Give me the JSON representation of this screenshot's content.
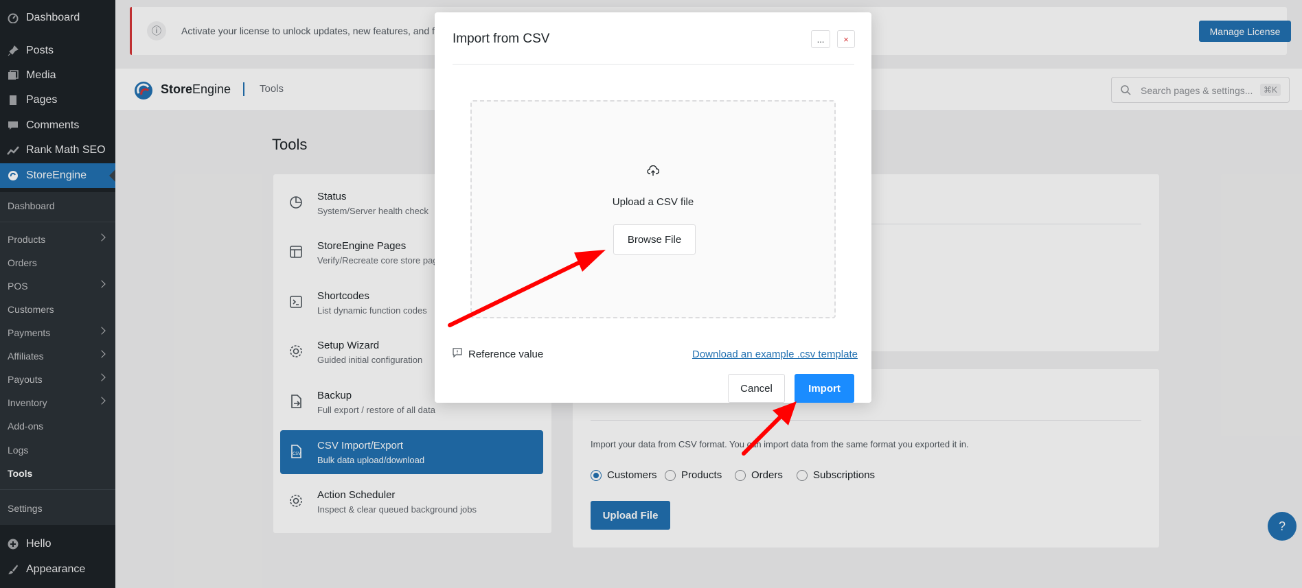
{
  "sidebar": {
    "items": [
      {
        "label": "Dashboard",
        "icon": "dashboard-icon"
      },
      {
        "label": "Posts",
        "icon": "pin-icon"
      },
      {
        "label": "Media",
        "icon": "media-icon"
      },
      {
        "label": "Pages",
        "icon": "pages-icon"
      },
      {
        "label": "Comments",
        "icon": "comment-icon"
      },
      {
        "label": "Rank Math SEO",
        "icon": "chart-icon"
      },
      {
        "label": "StoreEngine",
        "icon": "storeengine-icon"
      }
    ],
    "submenu": [
      {
        "label": "Dashboard"
      },
      {
        "label": "Products"
      },
      {
        "label": "Orders"
      },
      {
        "label": "POS"
      },
      {
        "label": "Customers"
      },
      {
        "label": "Payments"
      },
      {
        "label": "Affiliates"
      },
      {
        "label": "Payouts"
      },
      {
        "label": "Inventory"
      },
      {
        "label": "Add-ons"
      },
      {
        "label": "Logs"
      },
      {
        "label": "Tools"
      },
      {
        "label": "Settings"
      }
    ],
    "bottom": [
      {
        "label": "Hello",
        "icon": "plus-circle-icon"
      },
      {
        "label": "Appearance",
        "icon": "brush-icon"
      }
    ]
  },
  "license": {
    "text": "Activate your license to unlock updates, new features, and fu",
    "button": "Manage License"
  },
  "topbar": {
    "brand_bold": "Store",
    "brand_rest": "Engine",
    "crumb": "Tools",
    "search_placeholder": "Search pages & settings...",
    "search_kbd": "⌘K"
  },
  "tools": {
    "heading": "Tools",
    "items": [
      {
        "title": "Status",
        "desc": "System/Server health check"
      },
      {
        "title": "StoreEngine Pages",
        "desc": "Verify/Recreate core store pag"
      },
      {
        "title": "Shortcodes",
        "desc": "List dynamic function codes"
      },
      {
        "title": "Setup Wizard",
        "desc": "Guided initial configuration"
      },
      {
        "title": "Backup",
        "desc": "Full export / restore of all data"
      },
      {
        "title": "CSV Import/Export",
        "desc": "Bulk data upload/download"
      },
      {
        "title": "Action Scheduler",
        "desc": "Inspect & clear queued background jobs"
      }
    ]
  },
  "import_section": {
    "desc": "Import your data from CSV format. You can import data from the same format you exported it in.",
    "options": [
      "Customers",
      "Products",
      "Orders",
      "Subscriptions"
    ],
    "selected": "Customers",
    "upload_button": "Upload File"
  },
  "modal": {
    "title": "Import from CSV",
    "more": "...",
    "close": "×",
    "dropzone_label": "Upload a CSV file",
    "browse": "Browse File",
    "reference": "Reference value",
    "template_link": "Download an example .csv template",
    "cancel": "Cancel",
    "import": "Import"
  },
  "help": "?",
  "colors": {
    "accent": "#2271b1",
    "import_button": "#1a8cff",
    "annotation_arrow": "#ff0000"
  }
}
